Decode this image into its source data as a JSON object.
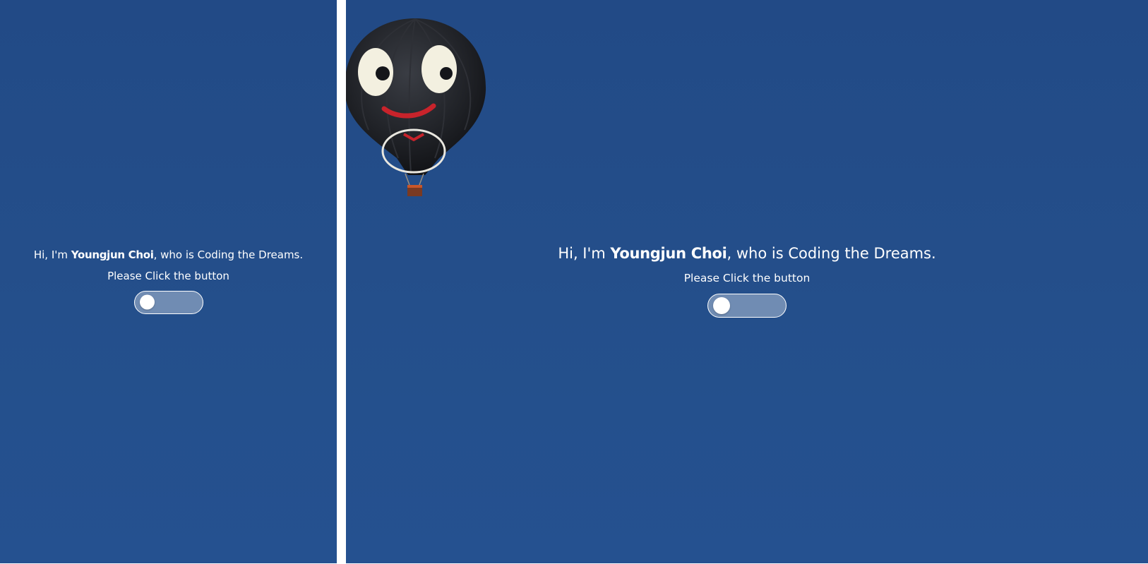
{
  "hero": {
    "greeting_prefix": "Hi, I'm ",
    "name": "Youngjun Choi",
    "greeting_suffix": ", who is Coding the Dreams.",
    "prompt": "Please Click the button"
  },
  "toggle": {
    "state": "off"
  },
  "colors": {
    "background": "#234d89",
    "text": "#ffffff",
    "divider": "#ffffff",
    "toggle_track": "rgba(255,255,255,0.35)",
    "toggle_knob": "#ffffff"
  },
  "icons": {
    "balloon": "hot-air-balloon-icon"
  }
}
